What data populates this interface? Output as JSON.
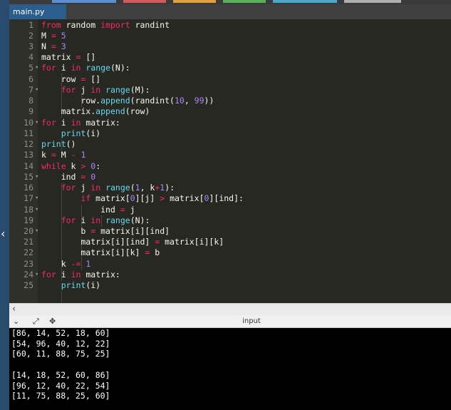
{
  "tab": {
    "filename": "main.py"
  },
  "editor": {
    "line_numbers": [
      "1",
      "2",
      "3",
      "4",
      "5",
      "6",
      "7",
      "8",
      "9",
      "10",
      "11",
      "12",
      "13",
      "14",
      "15",
      "16",
      "17",
      "18",
      "19",
      "20",
      "21",
      "22",
      "23",
      "24",
      "25"
    ]
  },
  "io": {
    "input_label": "input"
  },
  "output": {
    "lines": [
      "[86, 14, 52, 18, 60]",
      "[54, 96, 40, 12, 22]",
      "[60, 11, 88, 75, 25]",
      "",
      "[14, 18, 52, 60, 86]",
      "[96, 12, 40, 22, 54]",
      "[11, 75, 88, 25, 60]"
    ]
  },
  "colors": {
    "keyword": "#f92672",
    "builtin": "#66d9ef",
    "number": "#ae81ff",
    "method": "#a6e22e",
    "tab_active": "#2c5d8f"
  }
}
